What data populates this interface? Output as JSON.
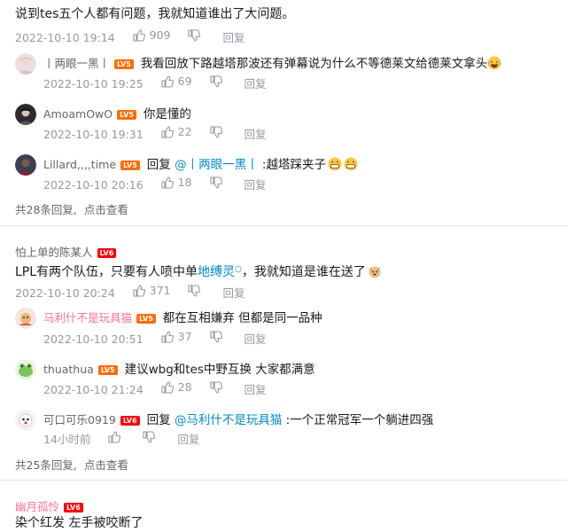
{
  "c1": {
    "text": "说到tes五个人都有问题，我就知道谁出了大问题。",
    "time": "2022-10-10 19:14",
    "likes": "909",
    "reply_label": "回复",
    "replies": [
      {
        "user": "丨两眼一黑丨",
        "level": "LV5",
        "text": "我看回放下路越塔那波还有弹幕说为什么不等德莱文给德莱文拿头",
        "time": "2022-10-10 19:25",
        "likes": "69",
        "reply_label": "回复"
      },
      {
        "user": "AmoamOwO",
        "level": "LV5",
        "text": "你是懂的",
        "time": "2022-10-10 19:31",
        "likes": "22",
        "reply_label": "回复"
      },
      {
        "user": "Lillard,,,,time",
        "level": "LV5",
        "prefix": "回复",
        "at": "@丨两眼一黑丨",
        "text": ":越塔踩夹子",
        "time": "2022-10-10 20:16",
        "likes": "18",
        "reply_label": "回复"
      }
    ],
    "summary_count": "共28条回复,",
    "summary_link": "点击查看"
  },
  "c2": {
    "user": "怕上单的陈某人",
    "level": "LV6",
    "text_before": "LPL有两个队伍，只要有人喷中单",
    "link": "地缚灵",
    "text_after": "，我就知道是谁在送了",
    "time": "2022-10-10 20:24",
    "likes": "371",
    "reply_label": "回复",
    "replies": [
      {
        "user": "马利什不是玩具猫",
        "level": "LV5",
        "text": "都在互相嫌弃 但都是同一品种",
        "time": "2022-10-10 20:51",
        "likes": "37",
        "reply_label": "回复"
      },
      {
        "user": "thuathua",
        "level": "LV5",
        "text": "建议wbg和tes中野互换 大家都满意",
        "time": "2022-10-10 21:24",
        "likes": "28",
        "reply_label": "回复"
      },
      {
        "user": "可口可乐0919",
        "level": "LV6",
        "prefix": "回复",
        "at": "@马利什不是玩具猫",
        "text": ":一个正常冠军一个躺进四强",
        "time": "14小时前",
        "likes": "",
        "reply_label": "回复"
      }
    ],
    "summary_count": "共25条回复,",
    "summary_link": "点击查看"
  },
  "c3": {
    "user": "幽月孤怜",
    "level": "LV6",
    "text": "染个红发 左手被咬断了"
  },
  "colors": {
    "meta": "#9499a0",
    "link": "#008ac5",
    "pink_name": "#fb7299",
    "level_badge": "#ff6c00",
    "level_badge_red": "#ff0000"
  }
}
